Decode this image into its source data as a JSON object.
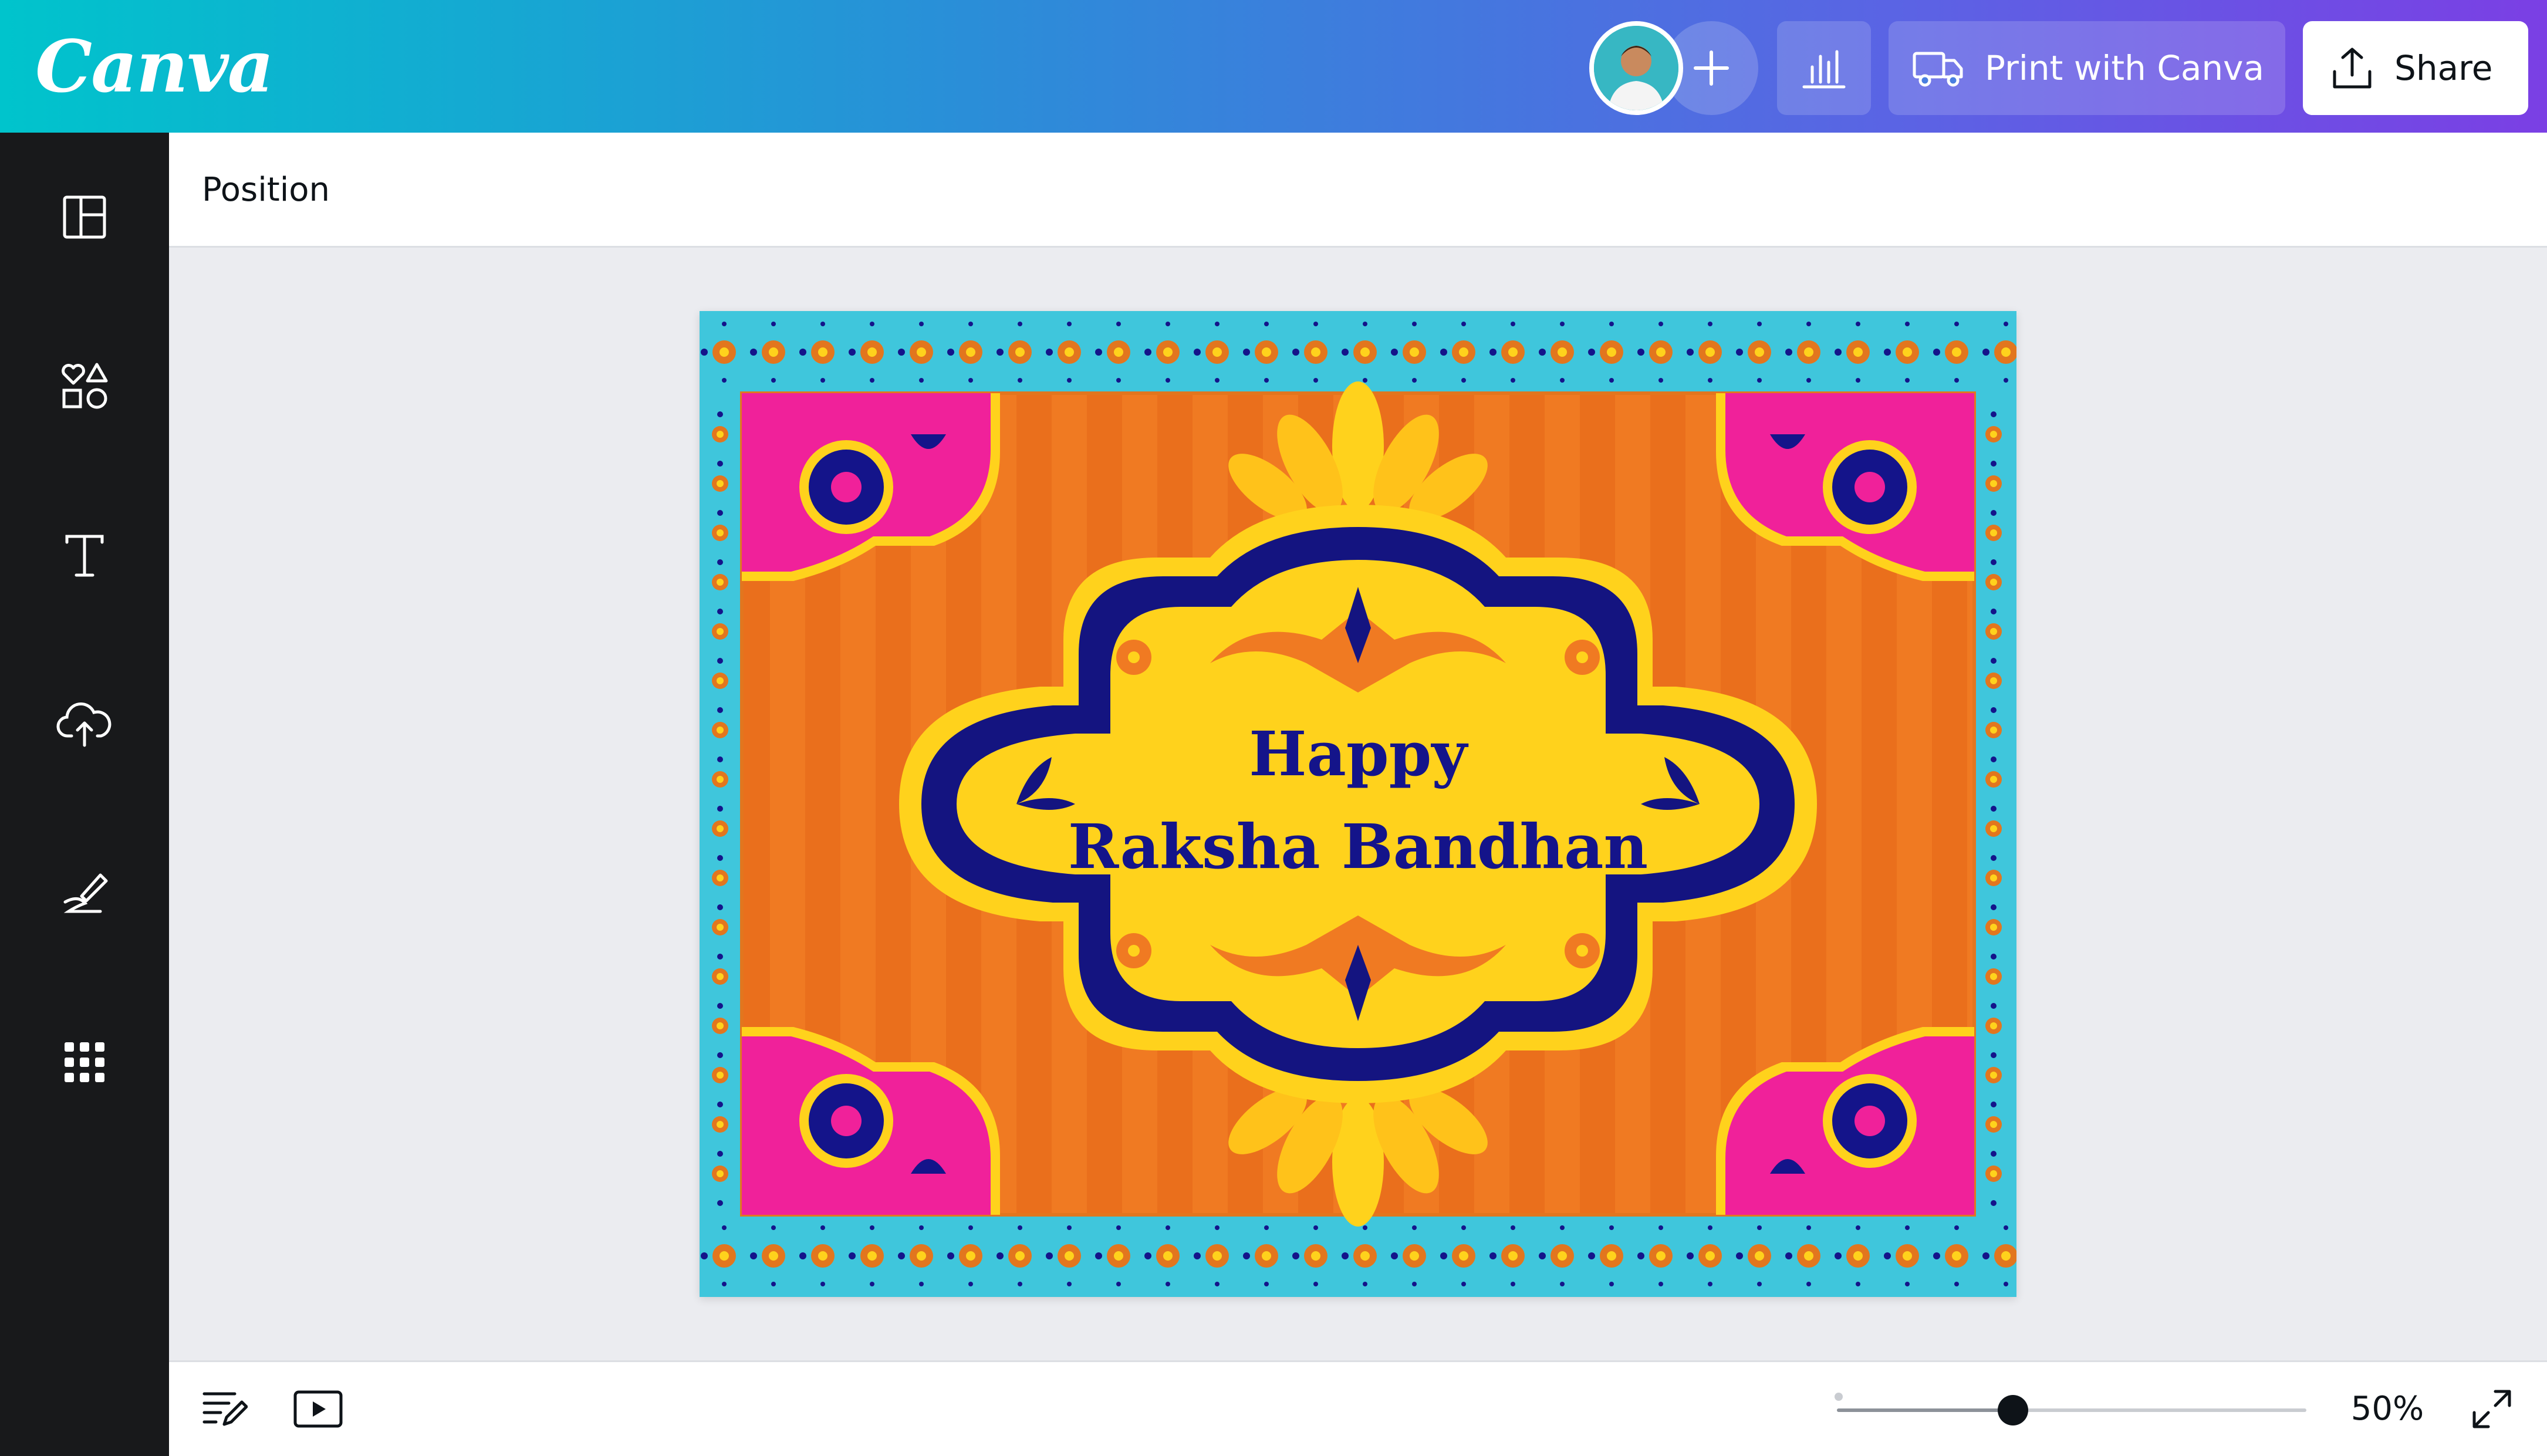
{
  "app": {
    "logo": "Canva"
  },
  "header": {
    "avatar_icon": "user-avatar",
    "add_collaborator_icon": "plus-icon",
    "insights_icon": "bar-chart-icon",
    "print_label": "Print with Canva",
    "print_icon": "truck-icon",
    "share_label": "Share",
    "share_icon": "upload-icon"
  },
  "sidebar": {
    "items": [
      {
        "name": "design",
        "icon": "layout-icon"
      },
      {
        "name": "elements",
        "icon": "shapes-icon"
      },
      {
        "name": "text",
        "icon": "text-icon"
      },
      {
        "name": "uploads",
        "icon": "cloud-upload-icon"
      },
      {
        "name": "draw",
        "icon": "pen-icon"
      },
      {
        "name": "apps",
        "icon": "grid-icon"
      }
    ]
  },
  "toolbar": {
    "position_label": "Position"
  },
  "design": {
    "line1": "Happy",
    "line2": "Raksha Bandhan",
    "colors": {
      "background": "#f07a22",
      "border": "#3fc6dc",
      "corner": "#f0219a",
      "frame_yellow": "#ffd21c",
      "frame_navy": "#141480"
    }
  },
  "footer": {
    "zoom_label": "50%",
    "zoom_value": 0.5,
    "notes_icon": "notes-icon",
    "present_icon": "play-icon",
    "fullscreen_icon": "expand-icon"
  },
  "colors": {
    "header_gradient_start": "#00c4cc",
    "header_gradient_end": "#7b3fe4",
    "rail": "#18191b",
    "workspace": "#ebecf0"
  }
}
